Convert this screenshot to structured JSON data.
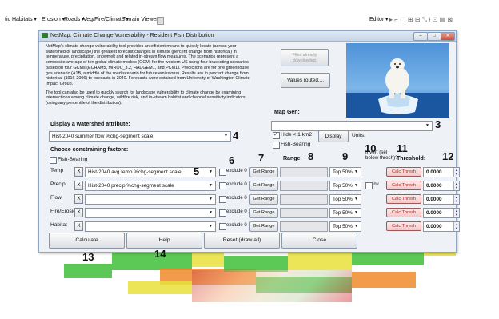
{
  "toolbar": {
    "menus": [
      {
        "label": "tic Habitats"
      },
      {
        "label": "Erosion"
      },
      {
        "label": "Roads"
      },
      {
        "label": "Veg/Fire/Climate"
      },
      {
        "label": "Terrain Viewer"
      }
    ],
    "editor_label": "Editor"
  },
  "dialog": {
    "title": "NetMap: Climate Change Vulnerability - Resident Fish Distribution",
    "description": [
      "NetMap's climate change vulnerability tool provides an efficient means to quickly locate (across your watershed or landscape) the greatest forecast changes in climate (percent change from historical) in temperature, precipitation, snowmelt and related in-stream flow measures. The scenarios represent a composite average of ten global climate models (GCM) for the western US using four bracketing scenarios based on four GCMs (ECHAM5, MIROC_3.2, HADGEM1, and PCM1). Predictions are for one greenhouse gas scenario (A1B, a middle of the road scenario for future emissions). Results are in percent change from historical (1916-2006) to forecasts in 2040. Forecasts were obtained from University of Washington Climate Impact Group.",
      "The tool can also be used to quickly search for landscape vulnerability to climate change by examining intersections among climate change, wildfire risk, and in-stream habitat and channel sensitivity indicators (using any percentile of the distribution)."
    ],
    "files_button": "Files already downloaded.",
    "values_button": "Values routed....",
    "map_gen_label": "Map Gen:",
    "map_gen_value": "",
    "hide_label": "Hide < 1 km2",
    "hide_checked": true,
    "display_button": "Display",
    "units_label": "Units:",
    "fish_bearing_right": "Fish-Bearing",
    "watershed_label": "Display a watershed attribute:",
    "watershed_value": "Hist-2040 summer flow %chg-segment scale",
    "constraining_label": "Choose constraining factors:",
    "fish_bearing_left": "Fish-Bearing",
    "range_header": "Range:",
    "invert_header": "Invert (sel below thresh)?",
    "threshold_header": "Threshold:",
    "exclude_label": "exclude 0",
    "getrange_label": "Get Range",
    "inv_label": "inv",
    "calcthresh_label": "Calc Thresh",
    "x_label": "X",
    "rows": [
      {
        "label": "Temp",
        "value": "Hist-2040 avg temp %chg-segment scale",
        "top": "Top 50%",
        "threshold": "0.0000"
      },
      {
        "label": "Precip",
        "value": "Hist-2040 precip %chg-segment scale",
        "top": "Top 50%",
        "threshold": "0.0000"
      },
      {
        "label": "Flow",
        "value": "",
        "top": "Top 50%",
        "threshold": "0.0000"
      },
      {
        "label": "Fire/Erosion",
        "value": "",
        "top": "Top 50%",
        "threshold": "0.0000"
      },
      {
        "label": "Habitat",
        "value": "",
        "top": "Top 50%",
        "threshold": "0.0000"
      }
    ],
    "buttons": {
      "calculate": "Calculate",
      "help": "Help",
      "reset": "Reset (draw all)",
      "close": "Close"
    }
  },
  "annotations": {
    "n3": "3",
    "n4": "4",
    "n5": "5",
    "n6": "6",
    "n7": "7",
    "n8": "8",
    "n9": "9",
    "n10": "10",
    "n11": "11",
    "n12": "12",
    "n13": "13",
    "n14": "14"
  },
  "colors": {
    "map_green": "#3fbf3a",
    "map_yellow": "#e8e03a",
    "map_orange": "#f08a2a",
    "calc_thresh_text": "#b32020"
  }
}
